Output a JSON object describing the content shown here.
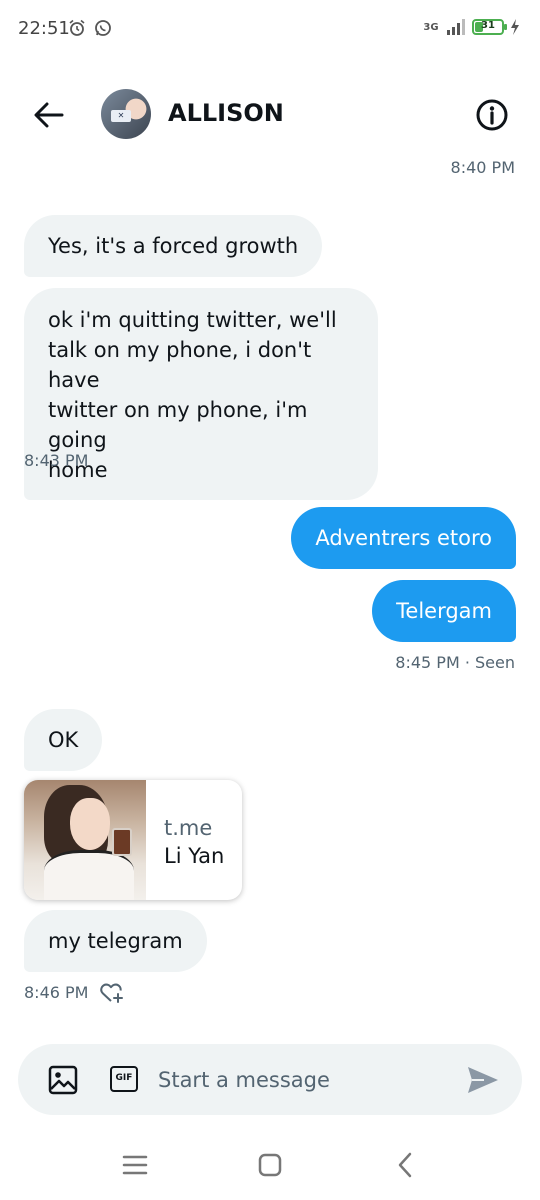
{
  "status_bar": {
    "time": "22:51",
    "network": "3G",
    "battery": "31",
    "battery_level": 0.31
  },
  "header": {
    "back_icon": "arrow-left-icon",
    "contact_name": "ALLISON",
    "info_icon": "info-circle-icon"
  },
  "messages": [
    {
      "timestamp": "8:40 PM"
    },
    {
      "direction": "incoming",
      "text": "Yes, it's a forced growth"
    },
    {
      "direction": "incoming",
      "text": "ok i'm quitting twitter, we'll talk on my phone, i don't have twitter on my phone, i'm going home",
      "lines": [
        "ok i'm quitting twitter, we'll",
        "talk on my phone, i don't have",
        "twitter on my phone, i'm going",
        "home"
      ]
    },
    {
      "timestamp": "8:43 PM"
    },
    {
      "direction": "outgoing",
      "text": "Adventrers etoro"
    },
    {
      "direction": "outgoing",
      "text": "Telergam"
    },
    {
      "timestamp": "8:45 PM · Seen"
    },
    {
      "direction": "incoming",
      "text": "OK"
    },
    {
      "direction": "incoming",
      "type": "link_card",
      "domain": "t.me",
      "title": "Li Yan"
    },
    {
      "direction": "incoming",
      "text": "my telegram"
    },
    {
      "timestamp": "8:46 PM",
      "reaction_icon": "heart-plus-icon"
    }
  ],
  "composer": {
    "placeholder": "Start a message",
    "image_icon": "image-icon",
    "gif_label": "GIF",
    "send_icon": "send-icon"
  },
  "colors": {
    "accent": "#1d9bf0",
    "incoming_bubble": "#eff3f4",
    "secondary_text": "#536471"
  }
}
